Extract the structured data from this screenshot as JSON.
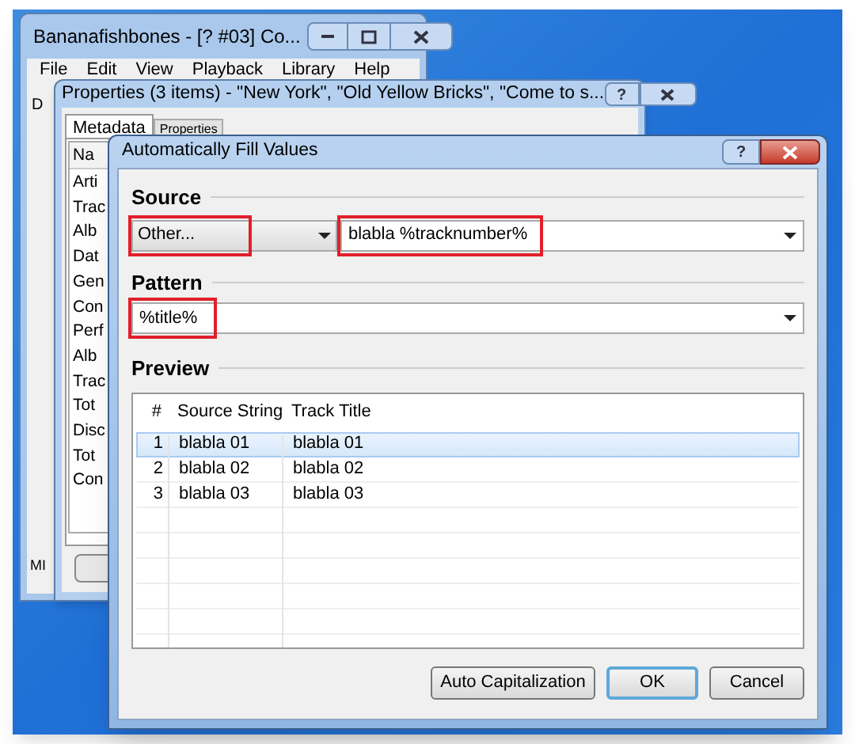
{
  "main_window": {
    "title": "Bananafishbones - [? #03] Co...",
    "menu": [
      "File",
      "Edit",
      "View",
      "Playback",
      "Library",
      "Help"
    ],
    "side_tab": "D",
    "bottom_label": "MI"
  },
  "properties_window": {
    "title": "Properties (3 items) - \"New York\", \"Old Yellow Bricks\", \"Come to s...",
    "help_label": "?",
    "tabs": [
      {
        "label": "Metadata",
        "selected": true
      },
      {
        "label": "Properties",
        "selected": false
      }
    ],
    "column_header": "Na",
    "rows": [
      "Arti",
      "Trac",
      "Alb",
      "Dat",
      "Gen",
      "Con",
      "Perf",
      "Alb",
      "Trac",
      "Tot",
      "Disc",
      "Tot",
      "Con"
    ]
  },
  "dialog": {
    "title": "Automatically Fill Values",
    "help_label": "?",
    "source": {
      "heading": "Source",
      "type": {
        "value": "Other...",
        "highlighted": true
      },
      "string": {
        "value": "blabla %tracknumber%",
        "highlighted": true
      }
    },
    "pattern": {
      "heading": "Pattern",
      "value": "%title%",
      "highlighted": true
    },
    "preview": {
      "heading": "Preview",
      "columns": [
        "#",
        "Source String",
        "Track Title"
      ],
      "rows": [
        {
          "number": "1",
          "source": "blabla 01",
          "title": "blabla 01",
          "selected": true
        },
        {
          "number": "2",
          "source": "blabla 02",
          "title": "blabla 02",
          "selected": false
        },
        {
          "number": "3",
          "source": "blabla 03",
          "title": "blabla 03",
          "selected": false
        }
      ]
    },
    "buttons": [
      {
        "label": "Auto Capitalization",
        "default": false
      },
      {
        "label": "OK",
        "default": true
      },
      {
        "label": "Cancel",
        "default": false
      }
    ]
  }
}
